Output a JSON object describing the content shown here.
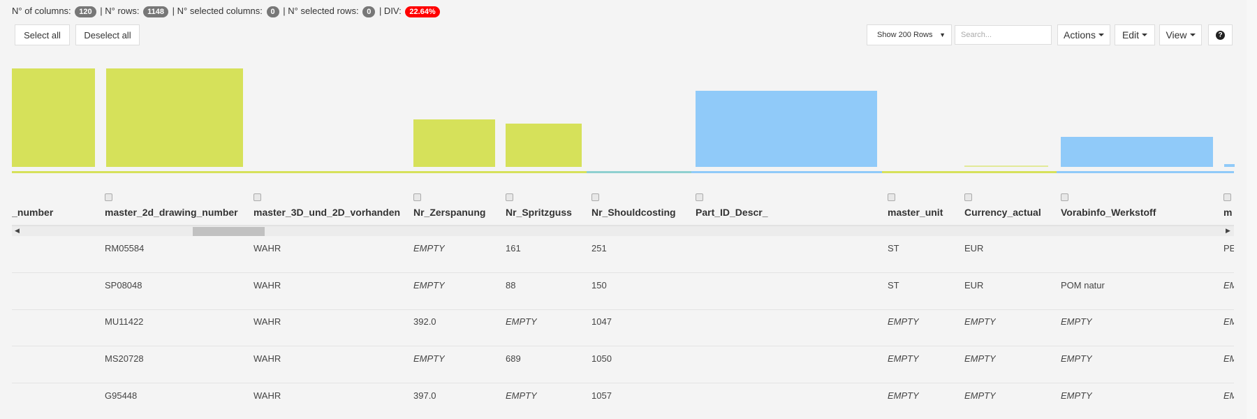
{
  "stats": {
    "columns_label": "N° of columns:",
    "columns": "120",
    "rows_label": "| N° rows:",
    "rows": "1148",
    "sel_cols_label": "| N° selected columns:",
    "sel_cols": "0",
    "sel_rows_label": "| N° selected rows:",
    "sel_rows": "0",
    "div_label": "| DIV:",
    "div": "22.64%"
  },
  "buttons": {
    "select_all": "Select all",
    "deselect_all": "Deselect all",
    "actions": "Actions",
    "edit": "Edit",
    "view": "View",
    "help_icon": "question-circle-icon"
  },
  "rows_select": {
    "selected": "Show 200 Rows"
  },
  "search": {
    "placeholder": "Search...",
    "value": ""
  },
  "colors": {
    "bar_green": "#d6e15a",
    "bar_blue": "#90caf9",
    "div_badge": "#ff0000"
  },
  "histogram_columns": [
    {
      "column": "cad_file_number",
      "fill": "green",
      "level": 1.0
    },
    {
      "column": "master_2d_drawing_number",
      "fill": "green",
      "level": 1.0
    },
    {
      "column": "master_3D_und_2D_vorhanden",
      "fill": "none",
      "level": 0
    },
    {
      "column": "Nr_Zerspanung",
      "fill": "green",
      "level": 0.48
    },
    {
      "column": "Nr_Spritzguss",
      "fill": "green",
      "level": 0.44
    },
    {
      "column": "Nr_Shouldcosting",
      "fill": "none",
      "level": 0
    },
    {
      "column": "Part_ID_Descr_",
      "fill": "blue",
      "level": 0.77
    },
    {
      "column": "master_unit",
      "fill": "none",
      "level": 0
    },
    {
      "column": "Currency_actual",
      "fill": "green",
      "level": 0.01
    },
    {
      "column": "Vorabinfo_Werkstoff",
      "fill": "blue",
      "level": 0.32
    },
    {
      "column": "m",
      "fill": "blue",
      "level": 0.03
    }
  ],
  "table": {
    "headers": [
      "cad_file_number",
      "master_2d_drawing_number",
      "master_3D_und_2D_vorhanden",
      "Nr_Zerspanung",
      "Nr_Spritzguss",
      "Nr_Shouldcosting",
      "Part_ID_Descr_",
      "master_unit",
      "Currency_actual",
      "Vorabinfo_Werkstoff",
      "m"
    ],
    "rows": [
      [
        "",
        "RM05584",
        "WAHR",
        "EMPTY",
        "161",
        "251",
        "",
        "ST",
        "EUR",
        "",
        "PE"
      ],
      [
        "",
        "SP08048",
        "WAHR",
        "EMPTY",
        "88",
        "150",
        "",
        "ST",
        "EUR",
        "POM natur",
        "EMPTY"
      ],
      [
        "",
        "MU11422",
        "WAHR",
        "392.0",
        "EMPTY",
        "1047",
        "",
        "EMPTY",
        "EMPTY",
        "EMPTY",
        "EMPTY"
      ],
      [
        "",
        "MS20728",
        "WAHR",
        "EMPTY",
        "689",
        "1050",
        "",
        "EMPTY",
        "EMPTY",
        "EMPTY",
        "EMPTY"
      ],
      [
        "",
        "G95448",
        "WAHR",
        "397.0",
        "EMPTY",
        "1057",
        "",
        "EMPTY",
        "EMPTY",
        "EMPTY",
        "EMPTY"
      ]
    ]
  }
}
